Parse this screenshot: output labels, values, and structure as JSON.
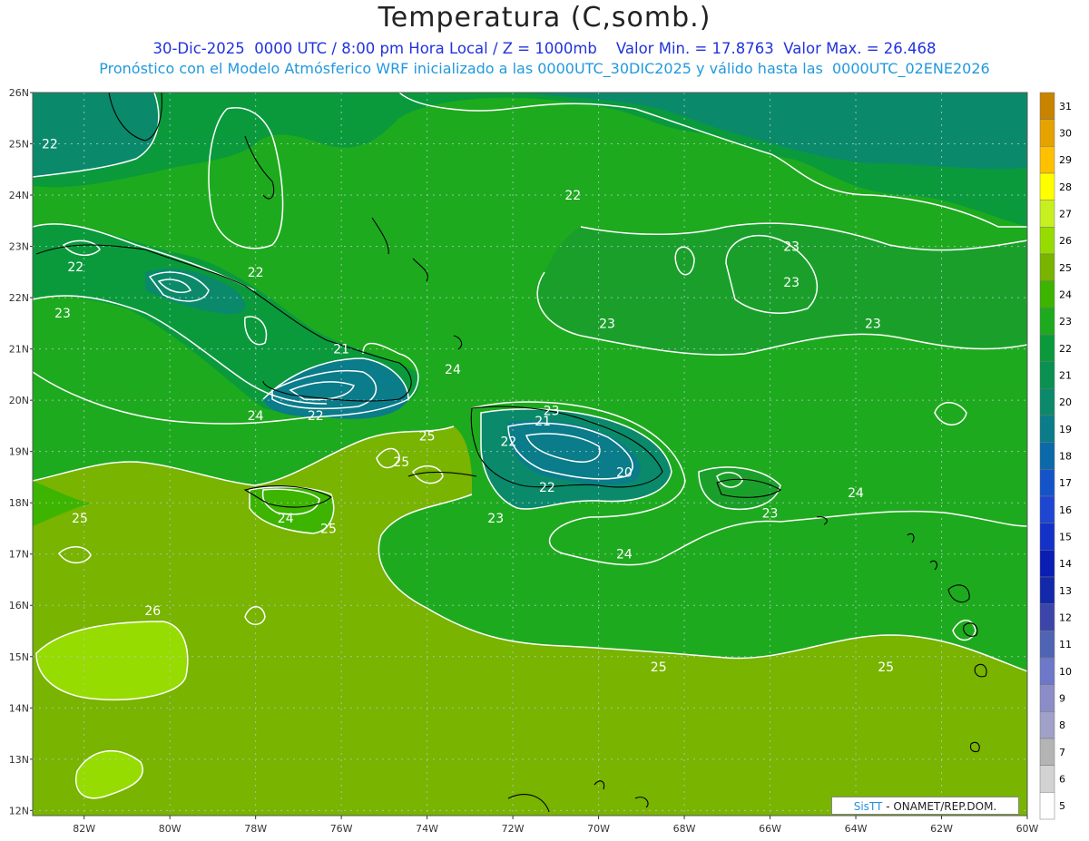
{
  "header": {
    "title": "Temperatura (C,somb.)",
    "line1": "30-Dic-2025  0000 UTC / 8:00 pm Hora Local / Z = 1000mb    Valor Min. = 17.8763  Valor Max. = 26.468",
    "line2": "Pronóstico con el Modelo Atmósferico WRF inicializado a las 0000UTC_30DIC2025 y válido hasta las  0000UTC_02ENE2026"
  },
  "axes": {
    "lat_labels": [
      "26N",
      "25N",
      "24N",
      "23N",
      "22N",
      "21N",
      "20N",
      "19N",
      "18N",
      "17N",
      "16N",
      "15N",
      "14N",
      "13N",
      "12N"
    ],
    "lon_labels": [
      "82W",
      "80W",
      "78W",
      "76W",
      "74W",
      "72W",
      "70W",
      "68W",
      "66W",
      "64W",
      "62W",
      "60W"
    ]
  },
  "contour_labels": [
    {
      "text": "22",
      "lon": -82.8,
      "lat": 25.0
    },
    {
      "text": "22",
      "lon": -82.2,
      "lat": 22.6
    },
    {
      "text": "22",
      "lon": -78.0,
      "lat": 22.5
    },
    {
      "text": "23",
      "lon": -82.5,
      "lat": 21.7
    },
    {
      "text": "22",
      "lon": -70.6,
      "lat": 24.0
    },
    {
      "text": "23",
      "lon": -65.5,
      "lat": 23.0
    },
    {
      "text": "23",
      "lon": -65.5,
      "lat": 22.3
    },
    {
      "text": "23",
      "lon": -63.6,
      "lat": 21.5
    },
    {
      "text": "23",
      "lon": -69.8,
      "lat": 21.5
    },
    {
      "text": "21",
      "lon": -76.0,
      "lat": 21.0
    },
    {
      "text": "24",
      "lon": -73.4,
      "lat": 20.6
    },
    {
      "text": "24",
      "lon": -78.0,
      "lat": 19.7
    },
    {
      "text": "22",
      "lon": -76.6,
      "lat": 19.7
    },
    {
      "text": "23",
      "lon": -71.1,
      "lat": 19.8
    },
    {
      "text": "21",
      "lon": -71.3,
      "lat": 19.6
    },
    {
      "text": "25",
      "lon": -74.0,
      "lat": 19.3
    },
    {
      "text": "25",
      "lon": -74.6,
      "lat": 18.8
    },
    {
      "text": "22",
      "lon": -72.1,
      "lat": 19.2
    },
    {
      "text": "20",
      "lon": -69.4,
      "lat": 18.6
    },
    {
      "text": "22",
      "lon": -71.2,
      "lat": 18.3
    },
    {
      "text": "24",
      "lon": -64.0,
      "lat": 18.2
    },
    {
      "text": "25",
      "lon": -82.1,
      "lat": 17.7
    },
    {
      "text": "24",
      "lon": -77.3,
      "lat": 17.7
    },
    {
      "text": "23",
      "lon": -72.4,
      "lat": 17.7
    },
    {
      "text": "23",
      "lon": -66.0,
      "lat": 17.8
    },
    {
      "text": "25",
      "lon": -76.3,
      "lat": 17.5
    },
    {
      "text": "24",
      "lon": -69.4,
      "lat": 17.0
    },
    {
      "text": "26",
      "lon": -80.4,
      "lat": 15.9
    },
    {
      "text": "25",
      "lon": -68.6,
      "lat": 14.8
    },
    {
      "text": "25",
      "lon": -63.3,
      "lat": 14.8
    }
  ],
  "legend": {
    "labels": [
      "31",
      "30",
      "29",
      "28",
      "27",
      "26",
      "25",
      "24",
      "23",
      "22",
      "21",
      "20",
      "19",
      "18",
      "17",
      "16",
      "15",
      "14",
      "13",
      "12",
      "11",
      "10",
      "9",
      "8",
      "7",
      "6",
      "5"
    ],
    "colors": [
      "#c88400",
      "#e6a200",
      "#ffc000",
      "#ffff00",
      "#c8f020",
      "#96dc00",
      "#78b400",
      "#3cb400",
      "#1eaa1e",
      "#0a9a3c",
      "#0a9050",
      "#0a8a6a",
      "#0a7c8a",
      "#0a6aaa",
      "#1454c8",
      "#1e46d2",
      "#1432c8",
      "#0a1eb4",
      "#1428aa",
      "#3c46aa",
      "#5064b4",
      "#6e78c8",
      "#8c8cc8",
      "#a0a0c8",
      "#b4b4b4",
      "#d2d2d2",
      "#ffffff"
    ]
  },
  "credit": {
    "brand": "SisTT",
    "rest": " - ONAMET/REP.DOM."
  }
}
